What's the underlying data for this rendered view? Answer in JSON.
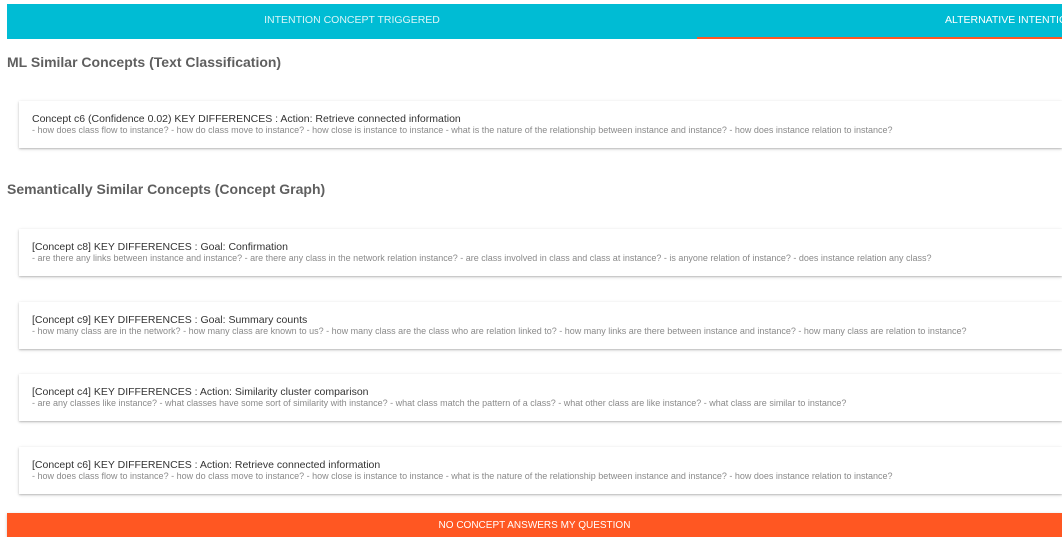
{
  "tabs": [
    {
      "label": "INTENTION CONCEPT TRIGGERED"
    },
    {
      "label": "ALTERNATIVE INTENTION"
    }
  ],
  "colors": {
    "tab_bar": "#00bcd4",
    "tab_indicator": "#ff5722",
    "primary_button": "#ff5722"
  },
  "ml_section": {
    "title": "ML Similar Concepts (Text Classification)",
    "items": [
      {
        "title": "Concept c6 (Confidence 0.02) KEY DIFFERENCES : Action: Retrieve connected information",
        "questions": "- how does class flow to instance? - how do class move to instance? - how close is instance to instance - what is the nature of the relationship between instance and instance? - how does instance relation to instance?"
      }
    ]
  },
  "graph_section": {
    "title": "Semantically Similar Concepts (Concept Graph)",
    "items": [
      {
        "title": "[Concept c8] KEY DIFFERENCES : Goal: Confirmation",
        "questions": "- are there any links between instance and instance? - are there any class in the network relation instance? - are class involved in class and class at instance? - is anyone relation of instance? - does instance relation any class?"
      },
      {
        "title": "[Concept c9] KEY DIFFERENCES : Goal: Summary counts",
        "questions": "- how many class are in the network? - how many class are known to us? - how many class are the class who are relation linked to? - how many links are there between instance and instance? - how many class are relation to instance?"
      },
      {
        "title": "[Concept c4] KEY DIFFERENCES : Action: Similarity cluster comparison",
        "questions": "- are any classes like instance? - what classes have some sort of similarity with instance? - what class match the pattern of a class? - what other class are like instance? - what class are similar to instance?"
      },
      {
        "title": "[Concept c6] KEY DIFFERENCES : Action: Retrieve connected information",
        "questions": "- how does class flow to instance? - how do class move to instance? - how close is instance to instance - what is the nature of the relationship between instance and instance? - how does instance relation to instance?"
      }
    ]
  },
  "no_concept_button": {
    "label": "NO CONCEPT ANSWERS MY QUESTION"
  }
}
